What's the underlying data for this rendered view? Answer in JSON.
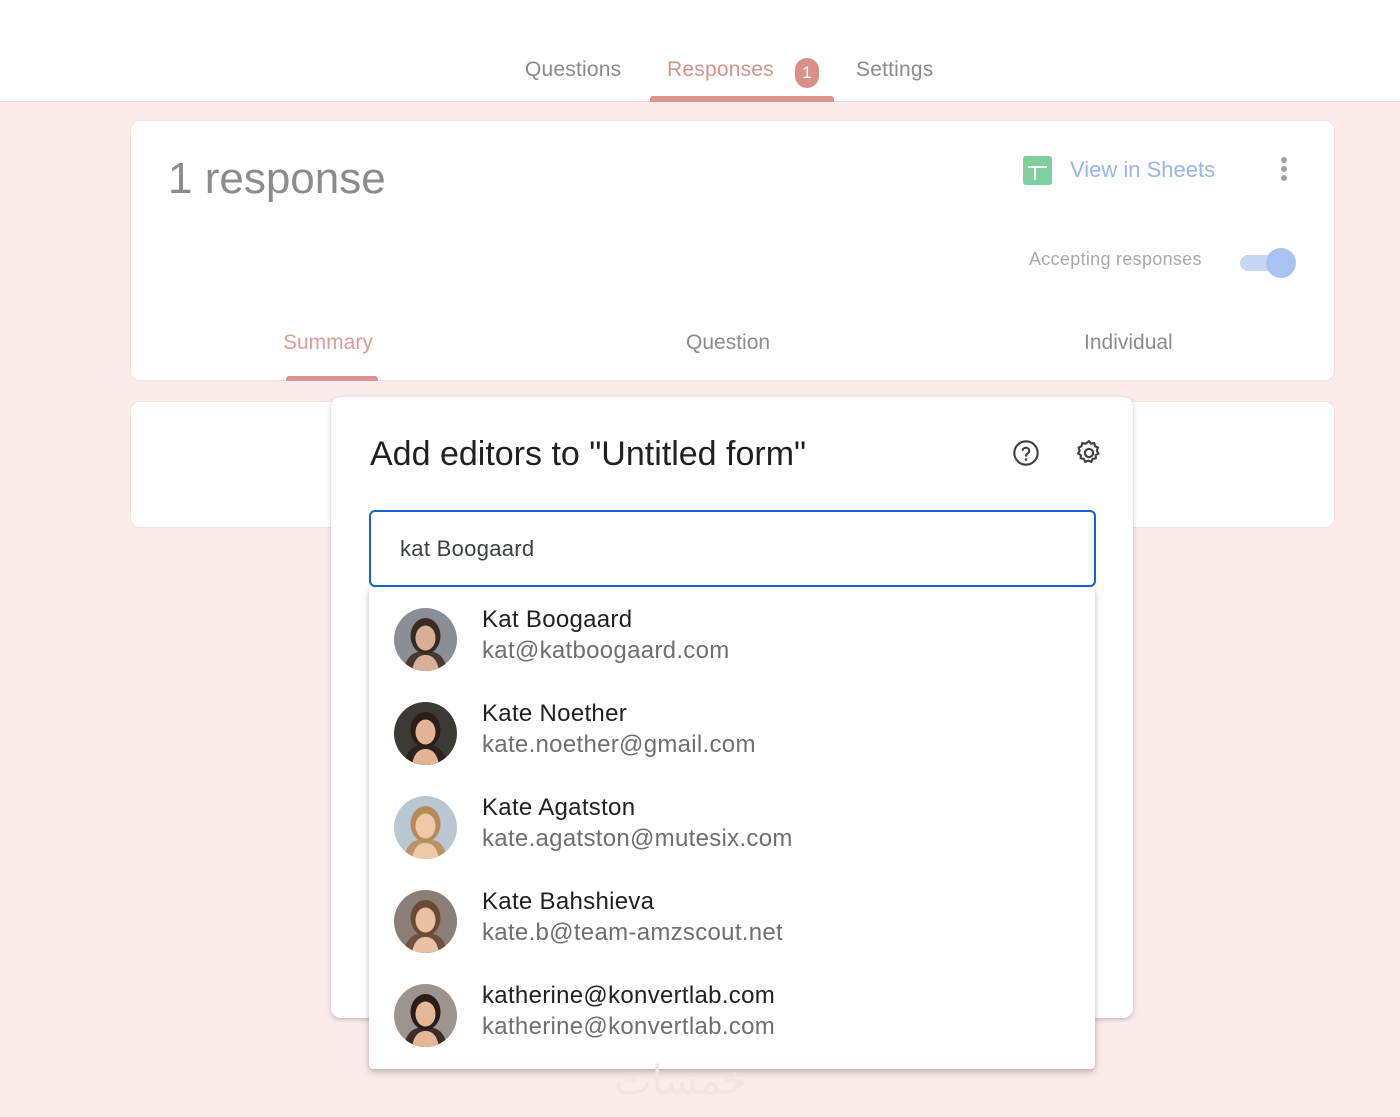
{
  "top_tabs": {
    "questions": "Questions",
    "responses": "Responses",
    "responses_count": "1",
    "settings": "Settings"
  },
  "response_card": {
    "title": "1 response",
    "view_in_sheets": "View in Sheets",
    "accepting_label": "Accepting responses",
    "accepting_on": true,
    "sub_tabs": {
      "summary": "Summary",
      "question": "Question",
      "individual": "Individual"
    }
  },
  "dialog": {
    "title": "Add editors to \"Untitled form\"",
    "search_value": "kat Boogaard"
  },
  "suggestions": [
    {
      "name": "Kat Boogaard",
      "email": "kat@katboogaard.com",
      "avatar_icon": "person-avatar",
      "avatar_bg": "#8a8f96",
      "hair": "#3a2b22",
      "skin": "#d9b095"
    },
    {
      "name": "Kate Noether",
      "email": "kate.noether@gmail.com",
      "avatar_icon": "person-avatar",
      "avatar_bg": "#3b3a36",
      "hair": "#2b1e17",
      "skin": "#e2b493"
    },
    {
      "name": "Kate Agatston",
      "email": "kate.agatston@mutesix.com",
      "avatar_icon": "person-avatar",
      "avatar_bg": "#b9c7d3",
      "hair": "#b88a55",
      "skin": "#efc8a8"
    },
    {
      "name": "Kate Bahshieva",
      "email": "kate.b@team-amzscout.net",
      "avatar_icon": "person-avatar",
      "avatar_bg": "#8a7e78",
      "hair": "#6a4a34",
      "skin": "#e9c1a3"
    },
    {
      "name": "katherine@konvertlab.com",
      "email": "katherine@konvertlab.com",
      "avatar_icon": "person-avatar",
      "avatar_bg": "#9c948e",
      "hair": "#2a1c16",
      "skin": "#e4b797"
    }
  ],
  "colors": {
    "accent": "#d4938b",
    "background": "#fbeceb",
    "sheets_green": "#7fcf9f",
    "link_blue": "#98b6ea",
    "focus_blue": "#1a62d2"
  }
}
